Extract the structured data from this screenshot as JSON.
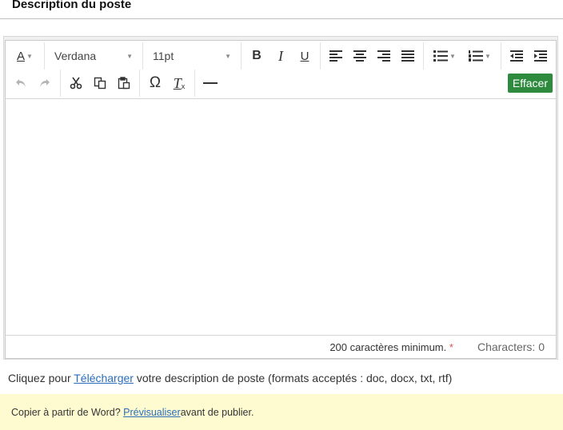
{
  "section": {
    "title": "Description du poste"
  },
  "toolbar": {
    "font_family": "Verdana",
    "font_size": "11pt",
    "clear_label": "Effacer",
    "icons": {
      "text_color": "A",
      "bold": "B",
      "italic": "I",
      "underline": "U",
      "special_char": "Ω",
      "remove_format": "T"
    }
  },
  "status": {
    "min_text": "200 caractères minimum.",
    "required_mark": "*",
    "char_count": "Characters: 0"
  },
  "upload": {
    "prefix": "Cliquez pour ",
    "link": "Télécharger",
    "suffix": " votre description de poste (formats acceptés : doc, docx, txt, rtf)"
  },
  "notice": {
    "prefix": "Copier à partir de Word? ",
    "link": "Prévisualiser",
    "suffix": " avant de publier."
  },
  "colors": {
    "accent_green": "#2e8b3e",
    "link_blue": "#2a6ebb",
    "notice_bg": "#fffbd1"
  }
}
